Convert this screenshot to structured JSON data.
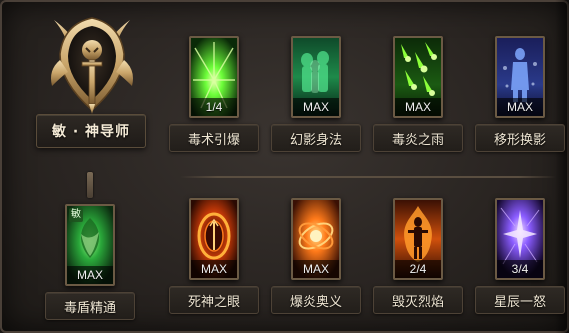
{
  "class_panel": {
    "title": "敏 · 神导师",
    "emblem_icon": "class-emblem-icon"
  },
  "passive": {
    "badge": "敏",
    "level": "MAX",
    "name": "毒盾精通",
    "icon": "poison-shield-icon"
  },
  "row1": [
    {
      "name": "毒术引爆",
      "level": "1/4",
      "icon": "poison-burst-icon"
    },
    {
      "name": "幻影身法",
      "level": "MAX",
      "icon": "phantom-step-icon"
    },
    {
      "name": "毒炎之雨",
      "level": "MAX",
      "icon": "toxic-rain-icon"
    },
    {
      "name": "移形换影",
      "level": "MAX",
      "icon": "shadow-shift-icon"
    }
  ],
  "row2": [
    {
      "name": "死神之眼",
      "level": "MAX",
      "icon": "death-eye-icon"
    },
    {
      "name": "爆炎奥义",
      "level": "MAX",
      "icon": "blast-flame-icon"
    },
    {
      "name": "毁灭烈焰",
      "level": "2/4",
      "icon": "doom-flame-icon"
    },
    {
      "name": "星辰一怒",
      "level": "3/4",
      "icon": "star-wrath-icon"
    }
  ],
  "colors": {
    "poison": "#3bd14a",
    "fire": "#ff7a1a",
    "arcane": "#8a5cff",
    "frame": "#6b5a44"
  }
}
